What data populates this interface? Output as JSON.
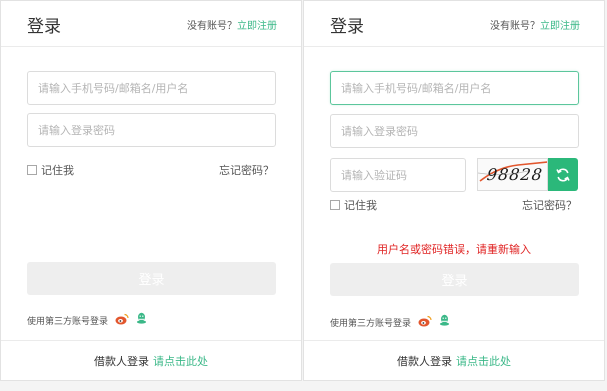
{
  "colors": {
    "accent": "#3bb888",
    "error": "#e02424",
    "refresh_bg": "#2bb87a",
    "weibo": "#e2562d"
  },
  "login_form": {
    "title": "登录",
    "no_account": "没有账号？",
    "register_link": "立即注册",
    "phone_placeholder": "请输入手机号码/邮箱名/用户名",
    "password_placeholder": "请输入登录密码",
    "captcha_placeholder": "请输入验证码",
    "captcha_text": "98828",
    "remember_label": "记住我",
    "forgot_link": "忘记密码？",
    "error_message": "用户名或密码错误，请重新输入",
    "submit_label": "登录",
    "third_party_label": "使用第三方账号登录",
    "third_party_icons": [
      "weibo-icon",
      "qq-icon"
    ],
    "footer_label": "借款人登录",
    "footer_link": "请点击此处"
  }
}
